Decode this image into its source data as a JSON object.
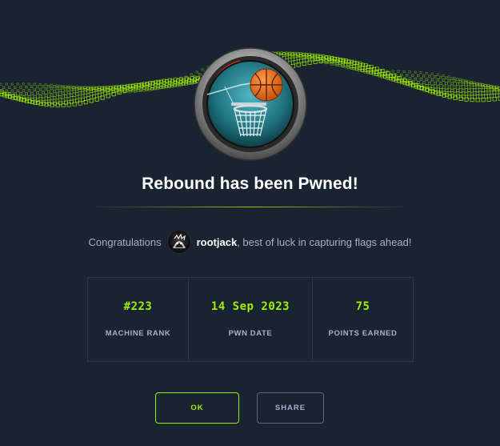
{
  "dialog": {
    "title": "Rebound has been Pwned!",
    "congrats_prefix": "Congratulations",
    "username": "rootjack",
    "congrats_suffix": ", best of luck in capturing flags ahead!"
  },
  "stats": [
    {
      "value": "#223",
      "label": "MACHINE RANK"
    },
    {
      "value": "14 Sep 2023",
      "label": "PWN DATE"
    },
    {
      "value": "75",
      "label": "POINTS EARNED"
    }
  ],
  "buttons": {
    "ok_label": "OK",
    "share_label": "SHARE"
  },
  "colors": {
    "background": "#1a2332",
    "accent": "#9fef00",
    "muted_text": "#a4b1cd"
  },
  "icons": {
    "badge": "basketball-hoop-icon",
    "avatar": "user-avatar"
  }
}
